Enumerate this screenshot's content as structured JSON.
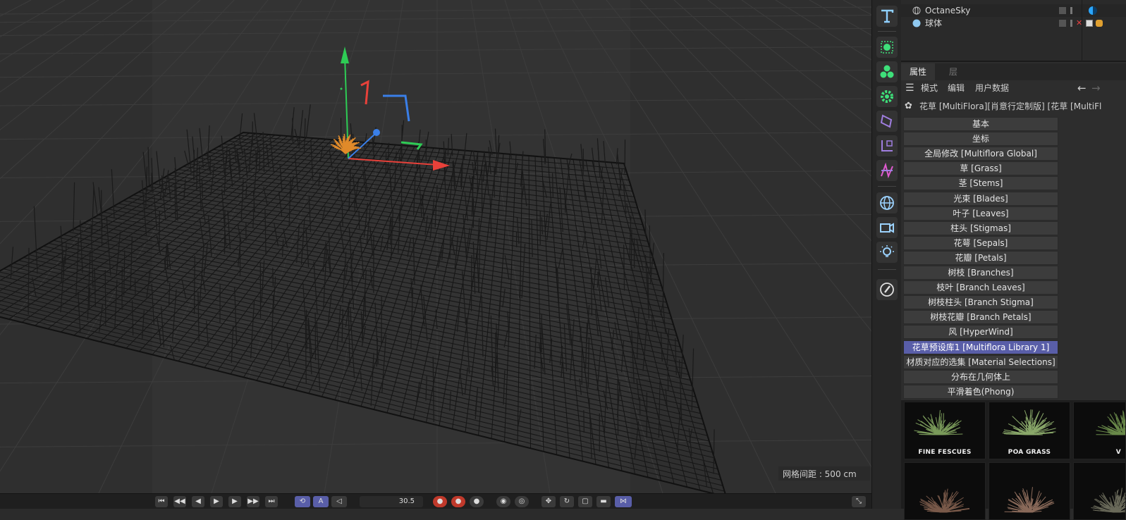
{
  "viewport": {
    "grid_spacing_label": "网格间距 : 500 cm"
  },
  "timeline": {
    "frame_value": "30.5"
  },
  "object_manager": {
    "objects": [
      {
        "name": "OctaneSky",
        "icon": "globe-icon"
      },
      {
        "name": "球体",
        "icon": "sphere-icon"
      }
    ]
  },
  "attributes": {
    "tabs": [
      "属性",
      "层"
    ],
    "menu": [
      "模式",
      "编辑",
      "用户数据"
    ],
    "object_title": "花草 [MultiFlora][肖意行定制版] [花草 [MultiFl",
    "sections": [
      "基本",
      "坐标",
      "全局修改 [Multiflora Global]",
      "草 [Grass]",
      "茎 [Stems]",
      "光束 [Blades]",
      "叶子 [Leaves]",
      "柱头 [Stigmas]",
      "花萼 [Sepals]",
      "花瓣 [Petals]",
      "树枝 [Branches]",
      "枝叶 [Branch Leaves]",
      "树枝柱头 [Branch Stigma]",
      "树枝花瓣 [Branch Petals]",
      "风 [HyperWind]",
      "花草预设库1 [Multiflora Library 1]",
      "材质对应的选集 [Material Selections]",
      "分布在几何体上",
      "平滑着色(Phong)"
    ],
    "selected_section": "花草预设库1 [Multiflora Library 1]"
  },
  "library": {
    "tiles": [
      "FINE FESCUES",
      "POA GRASS",
      "V",
      "",
      "",
      ""
    ]
  },
  "colors": {
    "selected": "#595ea8",
    "axis_x": "#e8413a",
    "axis_y": "#2ecc55",
    "axis_z": "#3a7fe8",
    "tool_accent": "#3ee07a"
  }
}
